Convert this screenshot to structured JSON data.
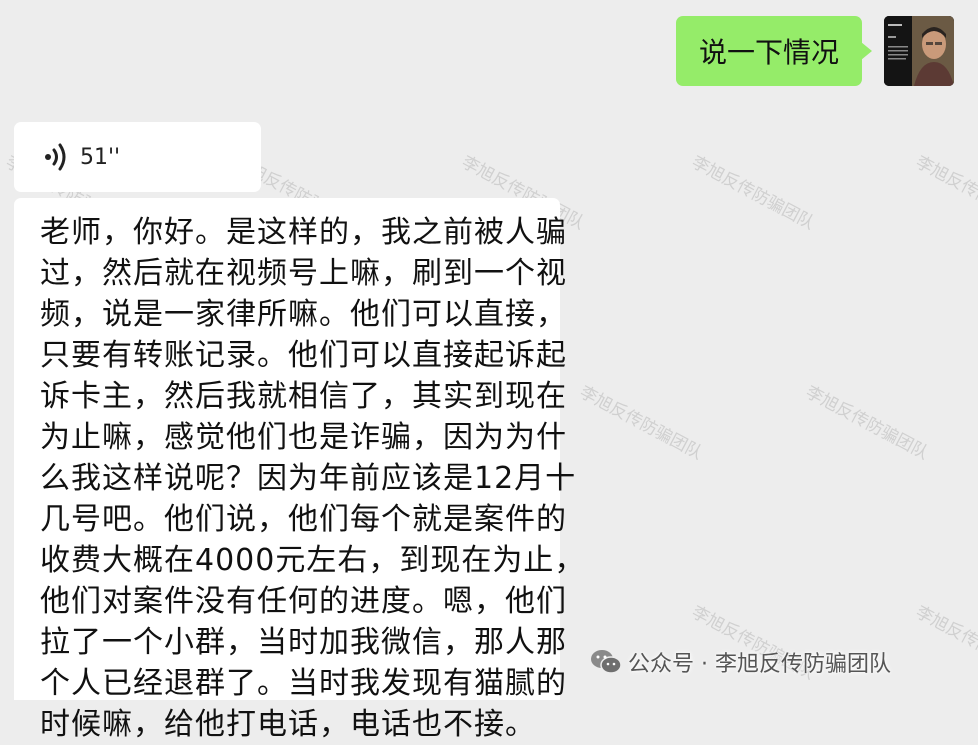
{
  "outgoing": {
    "text": "说一下情况"
  },
  "voice": {
    "duration": "51''",
    "icon": "voice-wave-icon"
  },
  "transcript": {
    "lines": [
      "老师，你好。是这样的，我之前被人骗",
      "过，然后就在视频号上嘛，刷到一个视",
      "频，说是一家律所嘛。他们可以直接，",
      "只要有转账记录。他们可以直接起诉起",
      "诉卡主，然后我就相信了，其实到现在",
      "为止嘛，感觉他们也是诈骗，因为为什",
      "么我这样说呢？因为年前应该是12月十",
      "几号吧。他们说，他们每个就是案件的",
      "收费大概在4000元左右，到现在为止，",
      "他们对案件没有任何的进度。嗯，他们",
      "拉了一个小群，当时加我微信，那人那",
      "个人已经退群了。当时我发现有猫腻的",
      "时候嘛，给他打电话，电话也不接。"
    ]
  },
  "watermark": {
    "text": "李旭反传防骗团队"
  },
  "footer": {
    "label": "公众号 · 李旭反传防骗团队",
    "icon": "wechat-icon"
  },
  "colors": {
    "background": "#ededed",
    "outgoing_bubble": "#95ec69",
    "incoming_bubble": "#ffffff"
  }
}
